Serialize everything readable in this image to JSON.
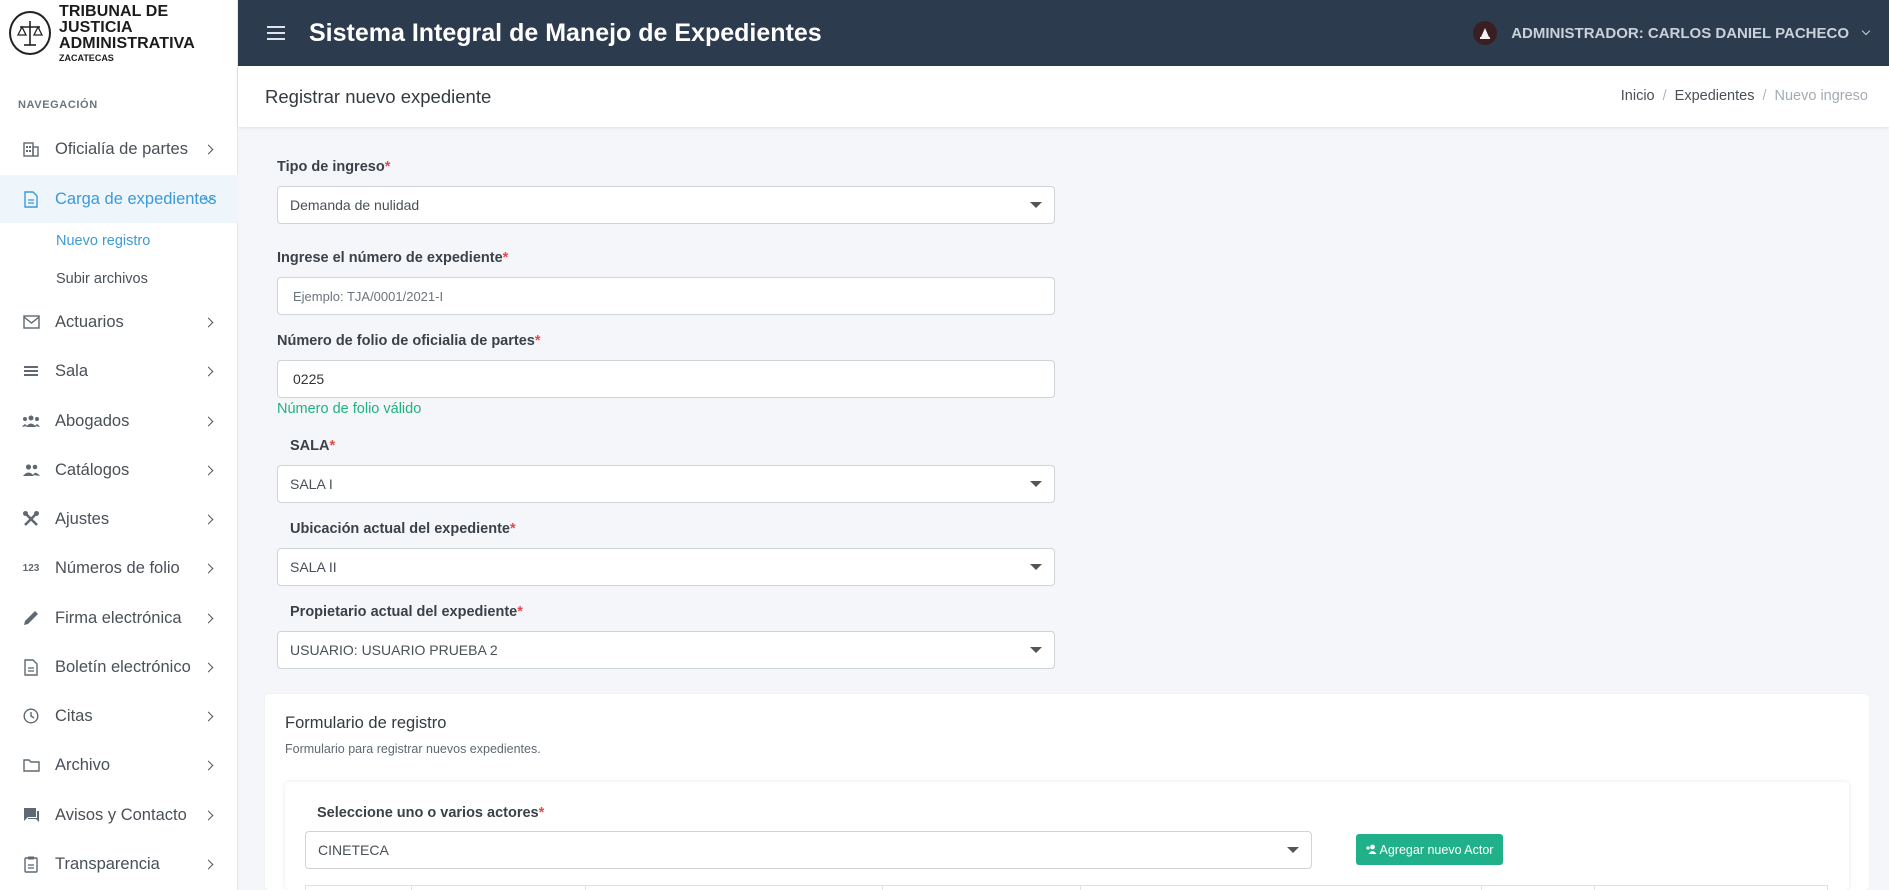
{
  "brand": {
    "line1": "TRIBUNAL DE JUSTICIA",
    "line2": "ADMINISTRATIVA",
    "line3": "ZACATECAS"
  },
  "sidebar": {
    "header": "NAVEGACIÓN",
    "items": [
      {
        "label": "Oficialía de partes",
        "icon": "building-icon"
      },
      {
        "label": "Carga de expedientes",
        "icon": "document-icon",
        "active": true
      },
      {
        "label": "Actuarios",
        "icon": "mail-icon"
      },
      {
        "label": "Sala",
        "icon": "list-icon"
      },
      {
        "label": "Abogados",
        "icon": "group-icon"
      },
      {
        "label": "Catálogos",
        "icon": "people-icon"
      },
      {
        "label": "Ajustes",
        "icon": "tools-icon"
      },
      {
        "label": "Números de folio",
        "icon": "numbers-icon",
        "icon_text": "123"
      },
      {
        "label": "Firma electrónica",
        "icon": "pen-icon"
      },
      {
        "label": "Boletín electrónico",
        "icon": "file-icon"
      },
      {
        "label": "Citas",
        "icon": "clock-icon"
      },
      {
        "label": "Archivo",
        "icon": "folder-icon"
      },
      {
        "label": "Avisos y Contacto",
        "icon": "chat-icon"
      },
      {
        "label": "Transparencia",
        "icon": "clipboard-icon"
      }
    ],
    "subitems": [
      {
        "label": "Nuevo registro",
        "active": true
      },
      {
        "label": "Subir archivos"
      }
    ]
  },
  "topbar": {
    "title": "Sistema Integral de Manejo de Expedientes",
    "user": "ADMINISTRADOR: CARLOS DANIEL PACHECO"
  },
  "page": {
    "title": "Registrar nuevo expediente",
    "breadcrumb": [
      "Inicio",
      "Expedientes",
      "Nuevo ingreso"
    ]
  },
  "form": {
    "required_mark": "*",
    "tipo_ingreso": {
      "label": "Tipo de ingreso",
      "value": "Demanda de nulidad"
    },
    "numero_expediente": {
      "label": "Ingrese el número de expediente",
      "placeholder": "Ejemplo: TJA/0001/2021-I"
    },
    "folio": {
      "label": "Número de folio de oficialia de partes",
      "value": "0225",
      "valid_msg": "Número de folio válido"
    },
    "sala": {
      "label": "SALA",
      "value": "SALA I"
    },
    "ubicacion": {
      "label": "Ubicación actual del expediente",
      "value": "SALA II"
    },
    "propietario": {
      "label": "Propietario actual del expediente",
      "value": "USUARIO: USUARIO PRUEBA 2"
    }
  },
  "registro": {
    "title": "Formulario de registro",
    "subtitle": "Formulario para registrar nuevos expedientes.",
    "actores": {
      "label": "Seleccione uno o varios actores",
      "value": "CINETECA"
    },
    "add_button": "Agregar nuevo Actor"
  },
  "colors": {
    "topbar": "#2d3b4e",
    "accent": "#3b9ad9",
    "success": "#20b27c",
    "button": "#20b08a",
    "required": "#e5484d"
  }
}
